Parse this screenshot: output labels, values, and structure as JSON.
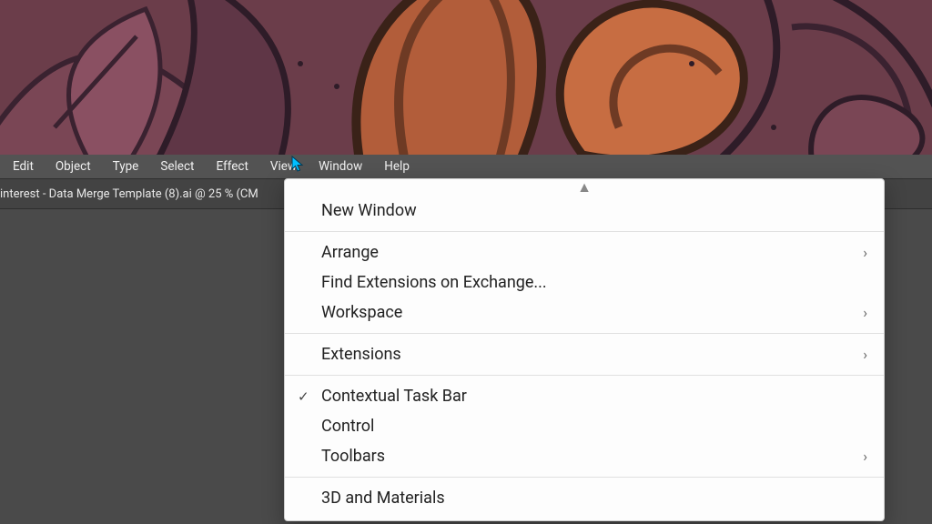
{
  "menubar": {
    "items": [
      "Edit",
      "Object",
      "Type",
      "Select",
      "Effect",
      "View",
      "Window",
      "Help"
    ]
  },
  "tab": {
    "title": "interest - Data Merge Template (8).ai @ 25 % (CM"
  },
  "window_menu": {
    "scrollup": "▲",
    "items": [
      {
        "label": "New Window",
        "submenu": false,
        "checked": false
      },
      {
        "sep": true
      },
      {
        "label": "Arrange",
        "submenu": true,
        "checked": false
      },
      {
        "label": "Find Extensions on Exchange...",
        "submenu": false,
        "checked": false
      },
      {
        "label": "Workspace",
        "submenu": true,
        "checked": false
      },
      {
        "sep": true
      },
      {
        "label": "Extensions",
        "submenu": true,
        "checked": false
      },
      {
        "sep": true
      },
      {
        "label": "Contextual Task Bar",
        "submenu": false,
        "checked": true
      },
      {
        "label": "Control",
        "submenu": false,
        "checked": false
      },
      {
        "label": "Toolbars",
        "submenu": true,
        "checked": false
      },
      {
        "sep": true
      },
      {
        "label": "3D and Materials",
        "submenu": false,
        "checked": false
      }
    ],
    "chev": "›",
    "check": "✓"
  }
}
